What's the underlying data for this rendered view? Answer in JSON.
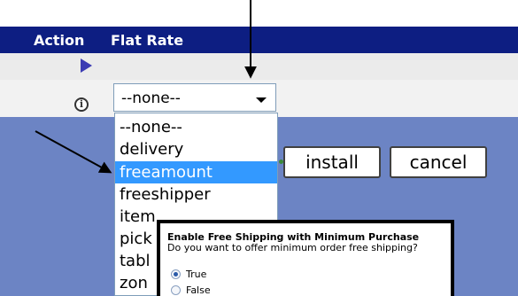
{
  "header": {
    "action_label": "Action",
    "flat_rate_label": "Flat Rate"
  },
  "icons": {
    "row_expand": "play-icon",
    "info": "info-icon"
  },
  "info_glyph": "i",
  "method_select": {
    "value": "--none--",
    "options": [
      "--none--",
      "delivery",
      "freeamount",
      "freeshipper",
      "item",
      "pick",
      "tabl",
      "zon"
    ],
    "highlighted_index": 2
  },
  "buttons": {
    "install_label": "install",
    "cancel_label": "cancel"
  },
  "tooltip": {
    "title": "Enable Free Shipping with Minimum Purchase",
    "question": "Do you want to offer minimum order free shipping?",
    "options": [
      {
        "label": "True",
        "checked": true
      },
      {
        "label": "False",
        "checked": false
      }
    ]
  },
  "colors": {
    "header_bar": "#0d1e82",
    "panel": "#6c84c4",
    "highlight": "#3399ff"
  }
}
